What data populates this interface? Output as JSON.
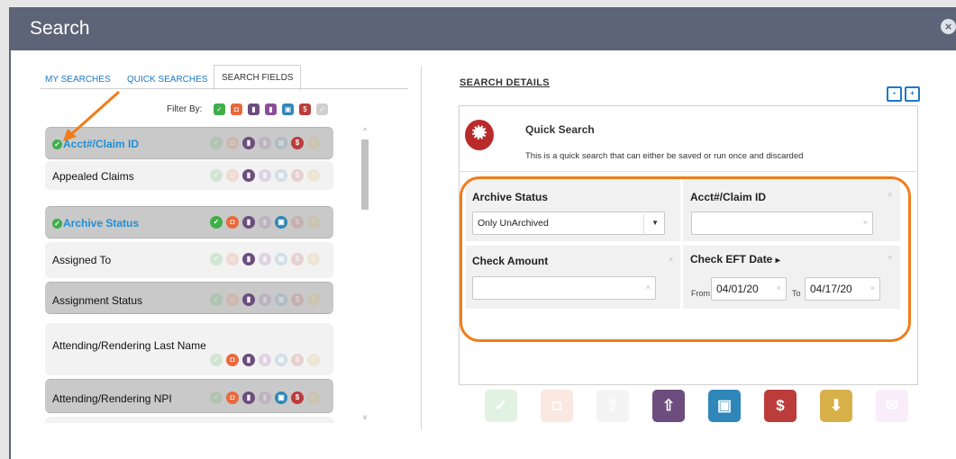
{
  "window": {
    "title": "Search",
    "close_label": "×"
  },
  "tabs": [
    {
      "label": "MY SEARCHES"
    },
    {
      "label": "QUICK SEARCHES"
    },
    {
      "label": "SEARCH FIELDS",
      "active": true
    }
  ],
  "filter": {
    "label": "Filter By:"
  },
  "colors": {
    "green": "#3eae49",
    "orange": "#e86a3c",
    "purple": "#6c4d7e",
    "violet": "#8a4e96",
    "blue": "#2f86b8",
    "red": "#bc3c3c",
    "tan": "#d8b04a",
    "grey": "#bdbdbd",
    "pink": "#d48ed6",
    "annotation": "#f07d1a",
    "accent": "#1f78c8"
  },
  "fields": [
    {
      "label": "Acct#/Claim ID",
      "selected": true,
      "active_icons": [
        "purple",
        "red"
      ]
    },
    {
      "label": "Appealed Claims",
      "selected": false,
      "active_icons": [
        "purple"
      ]
    },
    {
      "label": "Archive Status",
      "selected": true,
      "active_icons": [
        "green",
        "orange",
        "purple",
        "blue"
      ]
    },
    {
      "label": "Assigned To",
      "selected": false,
      "active_icons": [
        "purple"
      ]
    },
    {
      "label": "Assignment Status",
      "selected": false,
      "active_icons": [
        "purple"
      ]
    },
    {
      "label": "Attending/Rendering Last Name",
      "selected": false,
      "active_icons": [
        "orange",
        "purple"
      ]
    },
    {
      "label": "Attending/Rendering NPI",
      "selected": false,
      "active_icons": [
        "orange",
        "purple",
        "blue",
        "red"
      ]
    }
  ],
  "details": {
    "title": "SEARCH DETAILS",
    "save_icon": "floppy-icon",
    "save_as_icon": "floppy-plus-icon",
    "quick_title": "Quick Search",
    "quick_desc": "This is a quick search that can either be saved or run once and discarded",
    "badge_icon": "ribbon-award-icon",
    "archive_status": {
      "label": "Archive Status",
      "value": "Only UnArchived"
    },
    "acct_claim": {
      "label": "Acct#/Claim ID",
      "value": ""
    },
    "check_amount": {
      "label": "Check Amount",
      "value": ""
    },
    "check_eft": {
      "label": "Check EFT Date",
      "arrow": "▸",
      "from_label": "From",
      "from_value": "04/01/20",
      "to_label": "To",
      "to_value": "04/17/20"
    }
  },
  "bottom_buttons": [
    {
      "name": "check-button",
      "glyph": "✓",
      "color": "green",
      "enabled": false
    },
    {
      "name": "archive-button",
      "glyph": "◘",
      "color": "orange",
      "enabled": false
    },
    {
      "name": "doc-up-button",
      "glyph": "⇧",
      "color": "grey",
      "enabled": false
    },
    {
      "name": "docs-up-button",
      "glyph": "⇧",
      "color": "purple",
      "enabled": true
    },
    {
      "name": "folder-button",
      "glyph": "▣",
      "color": "blue",
      "enabled": true
    },
    {
      "name": "dollar-button",
      "glyph": "$",
      "color": "red",
      "enabled": true
    },
    {
      "name": "download-button",
      "glyph": "⬇",
      "color": "tan",
      "enabled": true
    },
    {
      "name": "mail-button",
      "glyph": "✉",
      "color": "pink",
      "enabled": false
    }
  ]
}
